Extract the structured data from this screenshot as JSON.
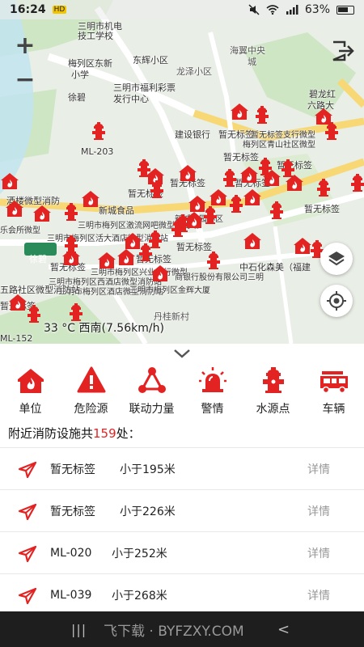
{
  "status_bar": {
    "time": "16:24",
    "hd_badge": "HD",
    "carrier_text": "三明市机电",
    "battery": "63%"
  },
  "map": {
    "labels": [
      "三明市机电",
      "技工学校",
      "梅列区东新",
      "小学",
      "东辉小区",
      "龙泽小区",
      "海翼中央",
      "城",
      "三明市福利彩票",
      "发行中心",
      "徐碧",
      "建设银行",
      "暂无标签",
      "暂无标签支行微型",
      "梅列区青山社区微型",
      "ML-203",
      "暂无标签",
      "暂无标签",
      "暂无标签",
      "酒楼微型消防",
      "暂无标签",
      "新城食品",
      "三明市梅列区激流网吧微型消防站",
      "暂无标签",
      "三明市梅列区活大酒店微型消防站",
      "暂无标签",
      "暂无标签",
      "三明市梅列区兴业支行微型",
      "三明市梅列区西酒店微型消防站",
      "三明市梅列区酒店微型消防站",
      "三明市梅列区金辉大厦",
      "中石化森美（福建",
      "丹桂新村",
      "五路社区微型消防站",
      "暂无标签",
      "ML-152",
      "商银行股份有限公司三明",
      "暂无标签",
      "新城普园小区",
      "六路大",
      "碧龙红",
      "徐碧",
      "暂无标签",
      "乐会所微型"
    ],
    "zoom_in": "+",
    "zoom_out": "−",
    "weather": "33 °C 西南(7.56km/h)"
  },
  "categories": [
    {
      "label": "单位",
      "icon": "building-flame-icon"
    },
    {
      "label": "危险源",
      "icon": "danger-warning-icon"
    },
    {
      "label": "联动力量",
      "icon": "linkage-network-icon"
    },
    {
      "label": "警情",
      "icon": "alarm-siren-icon"
    },
    {
      "label": "水源点",
      "icon": "fire-hydrant-icon"
    },
    {
      "label": "车辆",
      "icon": "fire-truck-icon"
    }
  ],
  "summary": {
    "prefix": "附近消防设施共",
    "count": "159",
    "suffix": "处："
  },
  "list": [
    {
      "name": "暂无标签",
      "distance": "小于195米",
      "detail": "详情"
    },
    {
      "name": "暂无标签",
      "distance": "小于226米",
      "detail": "详情"
    },
    {
      "name": "ML-020",
      "distance": "小于252米",
      "detail": "详情"
    },
    {
      "name": "ML-039",
      "distance": "小于268米",
      "detail": "详情"
    }
  ],
  "navbar": {
    "menu": "|||",
    "watermark": "飞下载 · BYFZXY.COM",
    "back": "<"
  },
  "colors": {
    "accent_red": "#e32222",
    "map_bg": "#e9eee6",
    "road": "#ffffff",
    "main_road": "#f7d875",
    "water": "#bfe3f0",
    "green": "#cfe6c5"
  }
}
